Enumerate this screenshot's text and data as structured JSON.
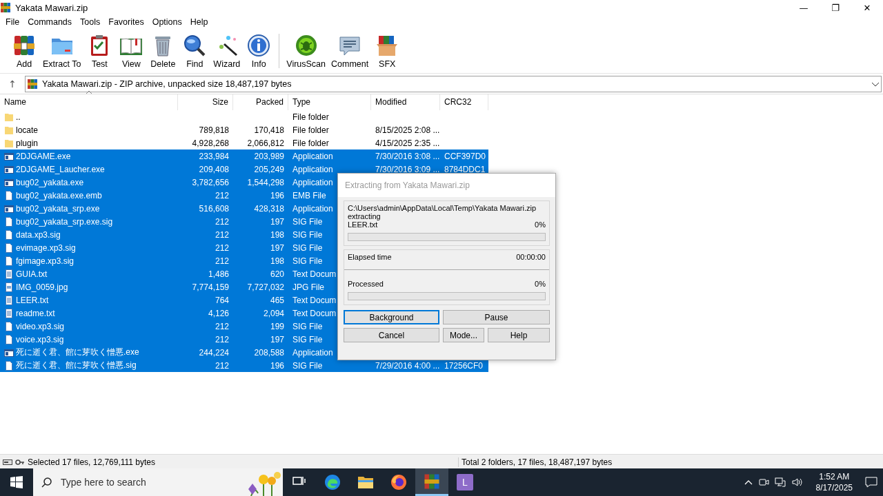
{
  "window": {
    "title": "Yakata Mawari.zip",
    "controls": [
      "—",
      "❐",
      "✕"
    ]
  },
  "menu": [
    "File",
    "Commands",
    "Tools",
    "Favorites",
    "Options",
    "Help"
  ],
  "toolbar": {
    "groups": [
      [
        "Add",
        "Extract To",
        "Test",
        "View",
        "Delete",
        "Find",
        "Wizard",
        "Info"
      ],
      [
        "VirusScan",
        "Comment",
        "SFX"
      ]
    ]
  },
  "address": {
    "up_button": "↑",
    "value": "Yakata Mawari.zip - ZIP archive, unpacked size 18,487,197 bytes"
  },
  "table": {
    "columns": [
      "Name",
      "Size",
      "Packed",
      "Type",
      "Modified",
      "CRC32"
    ],
    "rows": [
      {
        "kind": "folder",
        "selected": false,
        "cells": [
          "..",
          "",
          "",
          "File folder",
          "",
          ""
        ]
      },
      {
        "kind": "folder",
        "selected": false,
        "cells": [
          "locate",
          "789,818",
          "170,418",
          "File folder",
          "8/15/2025 2:08 ...",
          ""
        ]
      },
      {
        "kind": "folder",
        "selected": false,
        "cells": [
          "plugin",
          "4,928,268",
          "2,066,812",
          "File folder",
          "4/15/2025 2:35 ...",
          ""
        ]
      },
      {
        "kind": "exe",
        "selected": true,
        "cells": [
          "2DJGAME.exe",
          "233,984",
          "203,989",
          "Application",
          "7/30/2016 3:08 ...",
          "CCF397D0"
        ]
      },
      {
        "kind": "exe",
        "selected": true,
        "cells": [
          "2DJGAME_Laucher.exe",
          "209,408",
          "205,249",
          "Application",
          "7/30/2016 3:09 ...",
          "8784DDC1"
        ]
      },
      {
        "kind": "exe",
        "selected": true,
        "cells": [
          "bug02_yakata.exe",
          "3,782,656",
          "1,544,298",
          "Application",
          "",
          ""
        ]
      },
      {
        "kind": "file",
        "selected": true,
        "cells": [
          "bug02_yakata.exe.emb",
          "212",
          "196",
          "EMB File",
          "",
          ""
        ]
      },
      {
        "kind": "exe",
        "selected": true,
        "cells": [
          "bug02_yakata_srp.exe",
          "516,608",
          "428,318",
          "Application",
          "",
          ""
        ]
      },
      {
        "kind": "file",
        "selected": true,
        "cells": [
          "bug02_yakata_srp.exe.sig",
          "212",
          "197",
          "SIG File",
          "",
          ""
        ]
      },
      {
        "kind": "file",
        "selected": true,
        "cells": [
          "data.xp3.sig",
          "212",
          "198",
          "SIG File",
          "",
          ""
        ]
      },
      {
        "kind": "file",
        "selected": true,
        "cells": [
          "evimage.xp3.sig",
          "212",
          "197",
          "SIG File",
          "",
          ""
        ]
      },
      {
        "kind": "file",
        "selected": true,
        "cells": [
          "fgimage.xp3.sig",
          "212",
          "198",
          "SIG File",
          "",
          ""
        ]
      },
      {
        "kind": "text",
        "selected": true,
        "cells": [
          "GUIA.txt",
          "1,486",
          "620",
          "Text Docum",
          "",
          ""
        ]
      },
      {
        "kind": "image",
        "selected": true,
        "cells": [
          "IMG_0059.jpg",
          "7,774,159",
          "7,727,032",
          "JPG File",
          "",
          ""
        ]
      },
      {
        "kind": "text",
        "selected": true,
        "cells": [
          "LEER.txt",
          "764",
          "465",
          "Text Docum",
          "",
          ""
        ]
      },
      {
        "kind": "text",
        "selected": true,
        "cells": [
          "readme.txt",
          "4,126",
          "2,094",
          "Text Docum",
          "",
          ""
        ]
      },
      {
        "kind": "file",
        "selected": true,
        "cells": [
          "video.xp3.sig",
          "212",
          "199",
          "SIG File",
          "",
          ""
        ]
      },
      {
        "kind": "file",
        "selected": true,
        "cells": [
          "voice.xp3.sig",
          "212",
          "197",
          "SIG File",
          "",
          ""
        ]
      },
      {
        "kind": "exe",
        "selected": true,
        "cells": [
          "死に逝く君、館に芽吹く憎悪.exe",
          "244,224",
          "208,588",
          "Application",
          "",
          ""
        ]
      },
      {
        "kind": "file",
        "selected": true,
        "cells": [
          "死に逝く君、館に芽吹く憎悪.sig",
          "212",
          "196",
          "SIG File",
          "7/29/2016 4:00 ...",
          "17256CF0"
        ]
      }
    ]
  },
  "dialog": {
    "title": "Extracting from Yakata Mawari.zip",
    "path": "C:\\Users\\admin\\AppData\\Local\\Temp\\Yakata Mawari.zip",
    "action": "extracting",
    "file": "LEER.txt",
    "file_percent": "0%",
    "file_progress": {
      "level": 0
    },
    "elapsed_label": "Elapsed time",
    "elapsed": "00:00:00",
    "processed_label": "Processed",
    "processed_percent": "0%",
    "processed_progress": {
      "level": 0
    },
    "buttons": [
      {
        "label": "Background",
        "focused": true
      },
      {
        "label": "Pause",
        "focused": false
      },
      {
        "label": "Cancel",
        "focused": false
      },
      {
        "label": "Mode...",
        "focused": false
      },
      {
        "label": "Help",
        "focused": false
      }
    ]
  },
  "status_bar": {
    "left": "Selected 17 files, 12,769,111 bytes",
    "right": "Total 2 folders, 17 files, 18,487,197 bytes"
  },
  "taskbar": {
    "search": {
      "placeholder": "Type here to search"
    },
    "apps": [
      {
        "kind": "taskview",
        "selected": false
      },
      {
        "kind": "edge",
        "selected": false
      },
      {
        "kind": "explorer",
        "selected": false
      },
      {
        "kind": "firefox",
        "selected": false
      },
      {
        "kind": "winrar",
        "selected": true
      },
      {
        "kind": "letter",
        "label": "L",
        "selected": false
      }
    ],
    "time": "1:52 AM",
    "date": "8/17/2025"
  }
}
